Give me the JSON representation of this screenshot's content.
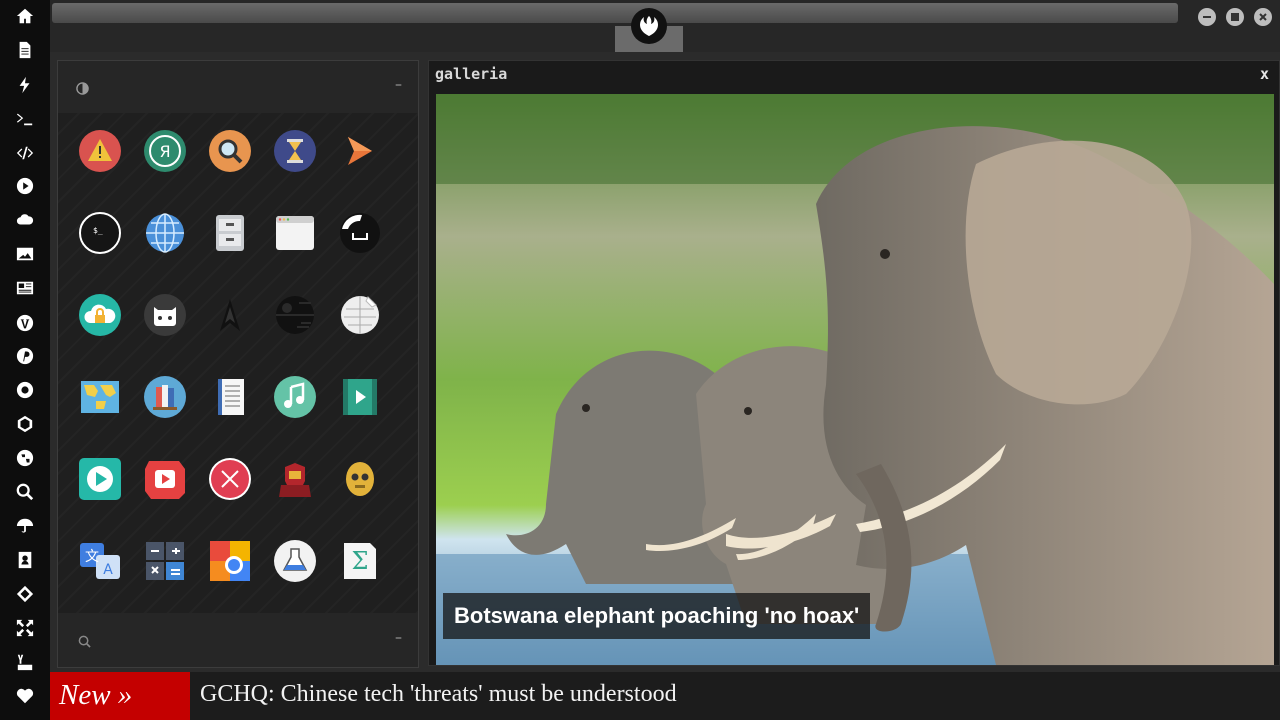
{
  "dock": {
    "items": [
      "home-icon",
      "document-icon",
      "bolt-icon",
      "terminal-icon",
      "code-icon",
      "play-icon",
      "cloud-icon",
      "image-icon",
      "newspaper-icon",
      "wordpress-icon",
      "pinterest-icon",
      "settings-icon",
      "network-icon",
      "globe-icon",
      "search-icon",
      "umbrella-icon",
      "contacts-icon",
      "git-icon",
      "expand-icon",
      "youtube-icon",
      "heart-icon"
    ]
  },
  "topbar": {
    "logo": "rebel-alliance-icon"
  },
  "launcher": {
    "head_icon": "contrast-icon",
    "collapse_label": "–",
    "foot_icon": "search-icon",
    "apps": [
      [
        "warning-app-icon",
        "yandex-app-icon",
        "search-app-icon",
        "hourglass-app-icon",
        "arrow-app-icon"
      ],
      [
        "terminal-app-icon",
        "globe-app-icon",
        "file-cabinet-app-icon",
        "window-app-icon",
        "ubuntu-app-icon"
      ],
      [
        "cloud-lock-app-icon",
        "github-app-icon",
        "starfleet-app-icon",
        "death-star-app-icon",
        "wikipedia-app-icon"
      ],
      [
        "map-app-icon",
        "books-app-icon",
        "notes-app-icon",
        "music-app-icon",
        "video-app-icon"
      ],
      [
        "player-app-icon",
        "youtube-app-icon",
        "close-app-icon",
        "ironman-app-icon",
        "c3po-app-icon"
      ],
      [
        "translate-app-icon",
        "calculator-app-icon",
        "photos-app-icon",
        "science-app-icon",
        "sigma-app-icon"
      ]
    ]
  },
  "gallery": {
    "title": "galleria",
    "close_label": "x",
    "caption": "Botswana elephant poaching 'no hoax'"
  },
  "ticker": {
    "badge": "New »",
    "headline": "GCHQ: Chinese tech 'threats' must be understood"
  }
}
